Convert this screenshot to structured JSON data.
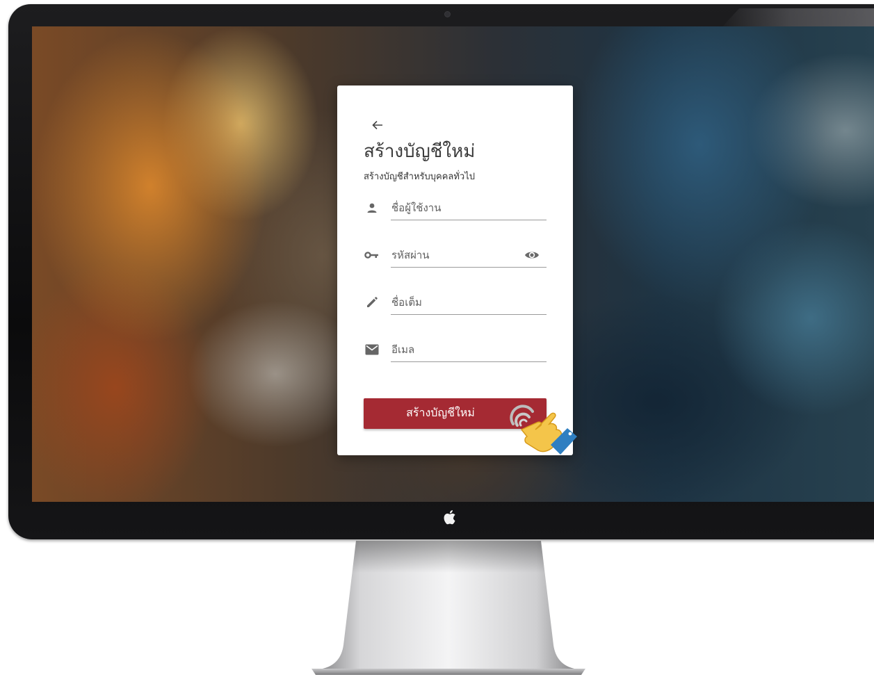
{
  "signup": {
    "title": "สร้างบัญชีใหม่",
    "subtitle": "สร้างบัญชีสำหรับบุคคลทั่วไป",
    "fields": {
      "username": {
        "placeholder": "ชื่อผู้ใช้งาน",
        "icon": "person-icon"
      },
      "password": {
        "placeholder": "รหัสผ่าน",
        "icon": "key-icon",
        "toggle_icon": "eye-icon"
      },
      "fullname": {
        "placeholder": "ชื่อเต็ม",
        "icon": "pencil-icon"
      },
      "email": {
        "placeholder": "อีเมล",
        "icon": "envelope-icon"
      }
    },
    "submit_label": "สร้างบัญชีใหม่",
    "back_icon": "arrow-left-icon"
  },
  "colors": {
    "accent": "#a52a33",
    "card": "#ffffff",
    "icon": "#666666"
  },
  "decor": {
    "monitor_logo_icon": "apple-logo-icon",
    "pointer_icon": "tap-hand-icon"
  }
}
